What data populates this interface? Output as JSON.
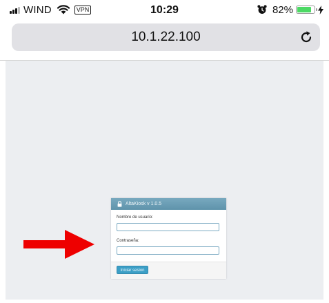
{
  "status_bar": {
    "carrier": "WIND",
    "vpn_label": "VPN",
    "time": "10:29",
    "battery_percent": "82%",
    "battery_level": 0.82,
    "battery_color": "#4cd964",
    "icons": [
      "signal-icon",
      "wifi-icon",
      "alarm-icon",
      "battery-icon",
      "charging-bolt-icon"
    ]
  },
  "address_bar": {
    "url": "10.1.22.100",
    "reload_icon": "reload-icon"
  },
  "login_panel": {
    "title": "AltaKiosk v 1.0.5",
    "header_color": "#6b9fb6",
    "username_label": "Nombre de usuario:",
    "username_value": "",
    "password_label": "Contraseña:",
    "password_value": "",
    "submit_label": "Iniciar sesion",
    "button_color": "#3c9fc6"
  },
  "annotation": {
    "arrow_color": "#ee0000"
  }
}
